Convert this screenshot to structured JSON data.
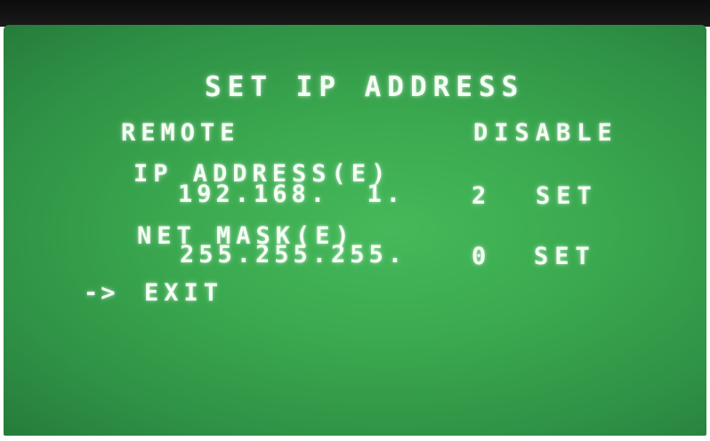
{
  "screen": {
    "title": "SET IP ADDRESS",
    "remote": {
      "label": "REMOTE",
      "value": "DISABLE"
    },
    "ip_address": {
      "label": "IP ADDRESS(E)",
      "value": "192.168.  1.",
      "last_octet": "2",
      "action": "SET"
    },
    "net_mask": {
      "label": "NET MASK(E)",
      "value": "255.255.255.",
      "last_octet": "0",
      "action": "SET"
    },
    "cursor": "->",
    "exit_label": "EXIT"
  },
  "colors": {
    "screen_green": "#3aa84f",
    "text": "#f4fff4",
    "bezel_top": "#0c0c0c"
  }
}
